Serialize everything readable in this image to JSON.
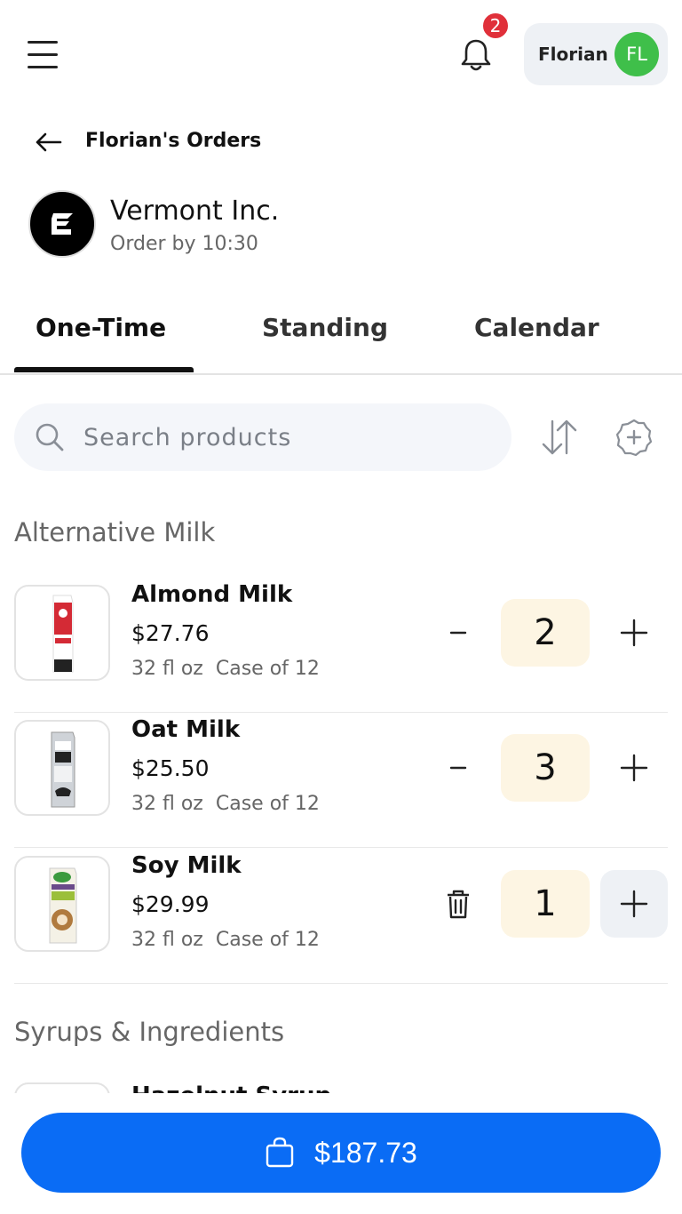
{
  "header": {
    "notification_count": "2",
    "user_name": "Florian",
    "user_initials": "FL",
    "avatar_color": "#3fbf4a"
  },
  "breadcrumb": {
    "title": "Florian's Orders"
  },
  "vendor": {
    "name": "Vermont Inc.",
    "subtitle": "Order by 10:30"
  },
  "tabs": [
    {
      "label": "One-Time",
      "active": true
    },
    {
      "label": "Standing",
      "active": false
    },
    {
      "label": "Calendar",
      "active": false
    }
  ],
  "search": {
    "placeholder": "Search products",
    "value": ""
  },
  "sections": [
    {
      "title": "Alternative Milk",
      "items": [
        {
          "name": "Almond Milk",
          "price": "$27.76",
          "size": "32 fl oz",
          "pack": "Case of 12",
          "quantity": "2",
          "left_action": "minus-icon"
        },
        {
          "name": "Oat Milk",
          "price": "$25.50",
          "size": "32 fl oz",
          "pack": "Case of 12",
          "quantity": "3",
          "left_action": "minus-icon"
        },
        {
          "name": "Soy Milk",
          "price": "$29.99",
          "size": "32 fl oz",
          "pack": "Case of 12",
          "quantity": "1",
          "left_action": "trash-icon"
        }
      ]
    },
    {
      "title": "Syrups & Ingredients",
      "items": [
        {
          "name": "Hazelnut Syrup"
        }
      ]
    }
  ],
  "cart": {
    "total": "$187.73",
    "color": "#0a6cf5"
  }
}
